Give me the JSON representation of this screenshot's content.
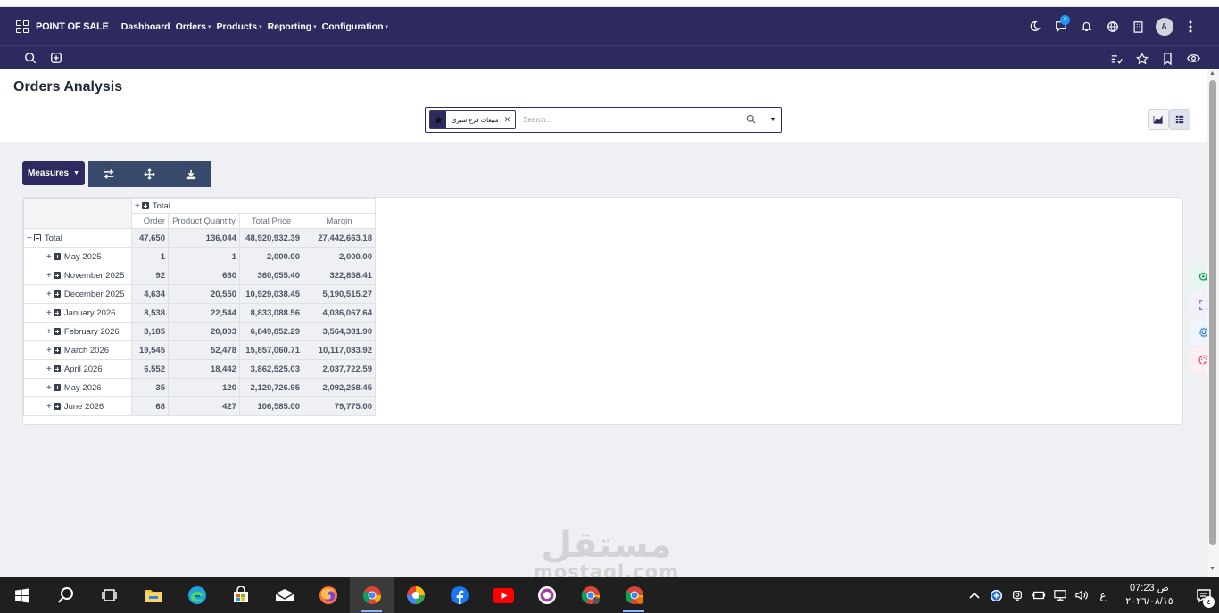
{
  "navbar": {
    "brand": "POINT OF SALE",
    "menu": [
      {
        "label": "Dashboard",
        "caret": ""
      },
      {
        "label": "Orders",
        "caret": "▾"
      },
      {
        "label": "Products",
        "caret": "▾"
      },
      {
        "label": "Reporting",
        "caret": "▾"
      },
      {
        "label": "Configuration",
        "caret": "▾"
      }
    ],
    "chat_badge": "4",
    "avatar_initial": "A"
  },
  "control_panel": {
    "title": "Orders Analysis",
    "search_facet": "مبيعات فرع شبرى",
    "search_placeholder": "Search...",
    "dropdown_caret": "▼"
  },
  "pivot": {
    "measures_label": "Measures",
    "measures_caret": "▼",
    "col_header_total": "Total",
    "measures": [
      "Order",
      "Product Quantity",
      "Total Price",
      "Margin"
    ],
    "total_row": {
      "label": "Total",
      "order": "47,650",
      "qty": "136,044",
      "price": "48,920,932.39",
      "margin": "27,442,663.18"
    },
    "rows": [
      {
        "label": "May 2025",
        "order": "1",
        "qty": "1",
        "price": "2,000.00",
        "margin": "2,000.00"
      },
      {
        "label": "November 2025",
        "order": "92",
        "qty": "680",
        "price": "360,055.40",
        "margin": "322,858.41"
      },
      {
        "label": "December 2025",
        "order": "4,634",
        "qty": "20,550",
        "price": "10,929,038.45",
        "margin": "5,190,515.27"
      },
      {
        "label": "January 2026",
        "order": "8,538",
        "qty": "22,544",
        "price": "8,833,088.56",
        "margin": "4,036,067.64"
      },
      {
        "label": "February 2026",
        "order": "8,185",
        "qty": "20,803",
        "price": "6,849,852.29",
        "margin": "3,564,381.90"
      },
      {
        "label": "March 2026",
        "order": "19,545",
        "qty": "52,478",
        "price": "15,857,060.71",
        "margin": "10,117,083.92"
      },
      {
        "label": "April 2026",
        "order": "6,552",
        "qty": "18,442",
        "price": "3,862,525.03",
        "margin": "2,037,722.59"
      },
      {
        "label": "May 2026",
        "order": "35",
        "qty": "120",
        "price": "2,120,726.95",
        "margin": "2,092,258.45"
      },
      {
        "label": "June 2026",
        "order": "68",
        "qty": "427",
        "price": "106,585.00",
        "margin": "79,775.00"
      }
    ]
  },
  "watermark": {
    "arabic": "مستقل",
    "latin": "mostaql.com"
  },
  "taskbar": {
    "tray_lang": "ع",
    "time": "07:23 ص",
    "date": "٢٠٢٦/٠٨/١٥",
    "notification_count": "٤"
  },
  "colors": {
    "navbar": "#2c2a5e",
    "accent_blue": "#2196f3",
    "content_bg": "#eef0f4",
    "tool_button": "#374a6b"
  }
}
